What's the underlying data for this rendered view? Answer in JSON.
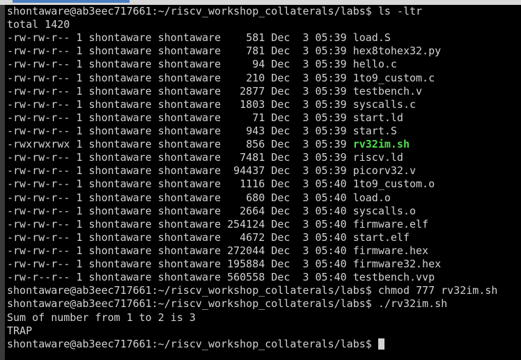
{
  "colors": {
    "background": "#000000",
    "text": "#d3d3d3",
    "executable": "#4ee04e"
  },
  "prompt": "shontaware@ab3eec717661:~/riscv_workshop_collaterals/labs$",
  "commands": [
    "ls -ltr",
    "chmod 777 rv32im.sh",
    "./rv32im.sh",
    ""
  ],
  "total": "total 1420",
  "listing": [
    {
      "perm": "-rw-rw-r--",
      "links": "1",
      "owner": "shontaware",
      "group": "shontaware",
      "size": "581",
      "month": "Dec",
      "day": "3",
      "time": "05:39",
      "name": "load.S",
      "exec": false
    },
    {
      "perm": "-rw-rw-r--",
      "links": "1",
      "owner": "shontaware",
      "group": "shontaware",
      "size": "781",
      "month": "Dec",
      "day": "3",
      "time": "05:39",
      "name": "hex8tohex32.py",
      "exec": false
    },
    {
      "perm": "-rw-rw-r--",
      "links": "1",
      "owner": "shontaware",
      "group": "shontaware",
      "size": "94",
      "month": "Dec",
      "day": "3",
      "time": "05:39",
      "name": "hello.c",
      "exec": false
    },
    {
      "perm": "-rw-rw-r--",
      "links": "1",
      "owner": "shontaware",
      "group": "shontaware",
      "size": "210",
      "month": "Dec",
      "day": "3",
      "time": "05:39",
      "name": "1to9_custom.c",
      "exec": false
    },
    {
      "perm": "-rw-rw-r--",
      "links": "1",
      "owner": "shontaware",
      "group": "shontaware",
      "size": "2877",
      "month": "Dec",
      "day": "3",
      "time": "05:39",
      "name": "testbench.v",
      "exec": false
    },
    {
      "perm": "-rw-rw-r--",
      "links": "1",
      "owner": "shontaware",
      "group": "shontaware",
      "size": "1803",
      "month": "Dec",
      "day": "3",
      "time": "05:39",
      "name": "syscalls.c",
      "exec": false
    },
    {
      "perm": "-rw-rw-r--",
      "links": "1",
      "owner": "shontaware",
      "group": "shontaware",
      "size": "71",
      "month": "Dec",
      "day": "3",
      "time": "05:39",
      "name": "start.ld",
      "exec": false
    },
    {
      "perm": "-rw-rw-r--",
      "links": "1",
      "owner": "shontaware",
      "group": "shontaware",
      "size": "943",
      "month": "Dec",
      "day": "3",
      "time": "05:39",
      "name": "start.S",
      "exec": false
    },
    {
      "perm": "-rwxrwxrwx",
      "links": "1",
      "owner": "shontaware",
      "group": "shontaware",
      "size": "856",
      "month": "Dec",
      "day": "3",
      "time": "05:39",
      "name": "rv32im.sh",
      "exec": true
    },
    {
      "perm": "-rw-rw-r--",
      "links": "1",
      "owner": "shontaware",
      "group": "shontaware",
      "size": "7481",
      "month": "Dec",
      "day": "3",
      "time": "05:39",
      "name": "riscv.ld",
      "exec": false
    },
    {
      "perm": "-rw-rw-r--",
      "links": "1",
      "owner": "shontaware",
      "group": "shontaware",
      "size": "94437",
      "month": "Dec",
      "day": "3",
      "time": "05:39",
      "name": "picorv32.v",
      "exec": false
    },
    {
      "perm": "-rw-rw-r--",
      "links": "1",
      "owner": "shontaware",
      "group": "shontaware",
      "size": "1116",
      "month": "Dec",
      "day": "3",
      "time": "05:40",
      "name": "1to9_custom.o",
      "exec": false
    },
    {
      "perm": "-rw-rw-r--",
      "links": "1",
      "owner": "shontaware",
      "group": "shontaware",
      "size": "680",
      "month": "Dec",
      "day": "3",
      "time": "05:40",
      "name": "load.o",
      "exec": false
    },
    {
      "perm": "-rw-rw-r--",
      "links": "1",
      "owner": "shontaware",
      "group": "shontaware",
      "size": "2664",
      "month": "Dec",
      "day": "3",
      "time": "05:40",
      "name": "syscalls.o",
      "exec": false
    },
    {
      "perm": "-rw-rw-r--",
      "links": "1",
      "owner": "shontaware",
      "group": "shontaware",
      "size": "254124",
      "month": "Dec",
      "day": "3",
      "time": "05:40",
      "name": "firmware.elf",
      "exec": false
    },
    {
      "perm": "-rw-rw-r--",
      "links": "1",
      "owner": "shontaware",
      "group": "shontaware",
      "size": "4672",
      "month": "Dec",
      "day": "3",
      "time": "05:40",
      "name": "start.elf",
      "exec": false
    },
    {
      "perm": "-rw-rw-r--",
      "links": "1",
      "owner": "shontaware",
      "group": "shontaware",
      "size": "272044",
      "month": "Dec",
      "day": "3",
      "time": "05:40",
      "name": "firmware.hex",
      "exec": false
    },
    {
      "perm": "-rw-rw-r--",
      "links": "1",
      "owner": "shontaware",
      "group": "shontaware",
      "size": "195884",
      "month": "Dec",
      "day": "3",
      "time": "05:40",
      "name": "firmware32.hex",
      "exec": false
    },
    {
      "perm": "-rw-r--r--",
      "links": "1",
      "owner": "shontaware",
      "group": "shontaware",
      "size": "560558",
      "month": "Dec",
      "day": "3",
      "time": "05:40",
      "name": "testbench.vvp",
      "exec": false
    }
  ],
  "output": [
    "Sum of number from 1 to 2 is 3",
    "TRAP"
  ]
}
